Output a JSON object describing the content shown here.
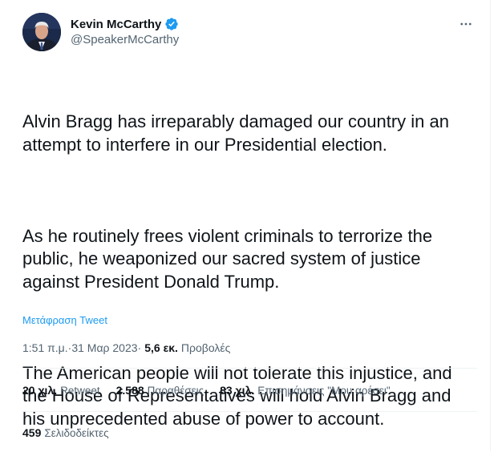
{
  "author": {
    "display_name": "Kevin McCarthy",
    "handle": "@SpeakerMcCarthy",
    "verified": true,
    "verified_color": "#1d9bf0"
  },
  "more_icon": "more-horizontal-icon",
  "tweet": {
    "paragraphs": [
      "Alvin Bragg has irreparably damaged our country in an attempt to interfere in our Presidential election.",
      "As he routinely frees violent criminals to terrorize the public, he weaponized our sacred system of justice against President Donald Trump.",
      "The American people will not tolerate this injustice, and the House of Representatives will hold Alvin Bragg and his unprecedented abuse of power to account."
    ],
    "translate_label": "Μετάφραση Tweet"
  },
  "meta": {
    "time": "1:51 π.μ.",
    "separator": " · ",
    "date": "31 Μαρ 2023",
    "views_count": "5,6 εκ.",
    "views_label": "Προβολές"
  },
  "stats": {
    "retweets": {
      "count": "20 χιλ.",
      "label": "Retweet"
    },
    "quotes": {
      "count": "2.588",
      "label": "Παραθέσεις"
    },
    "likes": {
      "count": "83 χιλ.",
      "label": "Επισημάνσεις \"Μου αρέσει\""
    },
    "bookmarks": {
      "count": "459",
      "label": "Σελιδοδείκτες"
    }
  },
  "colors": {
    "text_primary": "#0f1419",
    "text_secondary": "#536471",
    "link": "#1d9bf0",
    "divider": "#eff3f4"
  }
}
